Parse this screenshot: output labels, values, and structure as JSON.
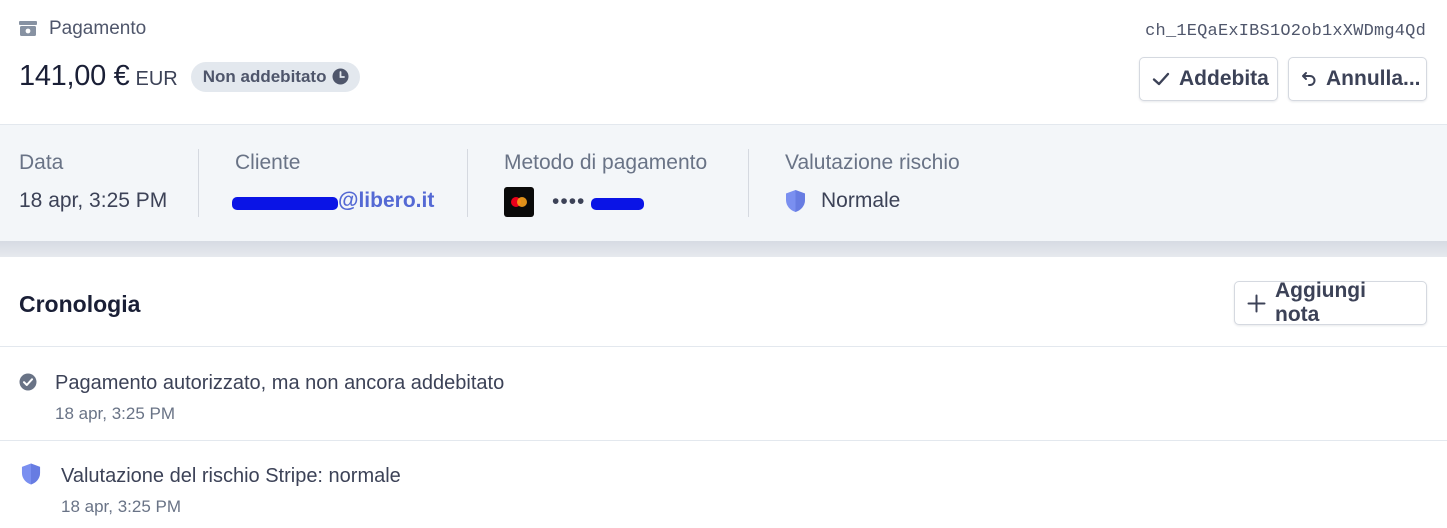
{
  "header": {
    "kind_label": "Pagamento",
    "kind_icon": "payment-icon",
    "charge_id": "ch_1EQaExIBS1O2ob1xXWDmg4Qd",
    "amount": "141,00 €",
    "currency": "EUR",
    "status_badge": "Non addebitato",
    "status_icon": "clock-icon",
    "actions": {
      "charge_label": "Addebita",
      "charge_icon": "checkmark-icon",
      "cancel_label": "Annulla...",
      "cancel_icon": "undo-arrow-icon"
    }
  },
  "summary": {
    "date": {
      "label": "Data",
      "value": "18 apr, 3:25 PM"
    },
    "customer": {
      "label": "Cliente",
      "email_visible": "@libero.it",
      "redacted": true
    },
    "payment_method": {
      "label": "Metodo di pagamento",
      "brand_icon": "mastercard-icon",
      "masked": "••••",
      "redacted": true
    },
    "risk": {
      "label": "Valutazione rischio",
      "value": "Normale",
      "icon": "shield-icon"
    }
  },
  "timeline": {
    "title": "Cronologia",
    "add_note_label": "Aggiungi nota",
    "add_note_icon": "plus-icon",
    "events": [
      {
        "icon": "check-circle-icon",
        "text": "Pagamento autorizzato, ma non ancora addebitato",
        "time": "18 apr, 3:25 PM"
      },
      {
        "icon": "shield-icon",
        "text": "Valutazione del rischio Stripe: normale",
        "time": "18 apr, 3:25 PM"
      }
    ]
  },
  "colors": {
    "accent": "#5469d4",
    "shield": "#7a8ff0",
    "redaction": "#0a14e6",
    "summary_bg": "#f3f6f9",
    "badge_bg": "#e3e8ee"
  }
}
